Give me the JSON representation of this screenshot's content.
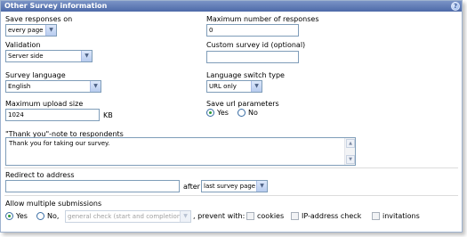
{
  "panel": {
    "title": "Other Survey information",
    "help_icon": "help-icon"
  },
  "left": {
    "save_responses_label": "Save responses on",
    "save_responses_value": "every page",
    "validation_label": "Validation",
    "validation_value": "Server side",
    "survey_language_label": "Survey language",
    "survey_language_value": "English",
    "max_upload_label": "Maximum upload size",
    "max_upload_value": "1024",
    "max_upload_unit": "KB"
  },
  "right": {
    "max_responses_label": "Maximum number of responses",
    "max_responses_value": "0",
    "custom_id_label": "Custom survey id (optional)",
    "custom_id_value": "",
    "lang_switch_label": "Language switch type",
    "lang_switch_value": "URL only",
    "save_url_label": "Save url parameters",
    "save_url_yes": "Yes",
    "save_url_no": "No",
    "save_url_selected": "Yes"
  },
  "thanks": {
    "label": "\"Thank you\"-note to respondents",
    "value": "Thank you for taking our survey."
  },
  "redirect": {
    "label": "Redirect to address",
    "value": "",
    "after_label": "after",
    "after_value": "last survey page"
  },
  "multiple": {
    "label": "Allow multiple submissions",
    "yes": "Yes",
    "no": "No,",
    "selected": "Yes",
    "check_value": "general check (start and completion)",
    "prevent_label": ", prevent with:",
    "opt_cookies": "cookies",
    "opt_ip": "IP-address check",
    "opt_invitations": "invitations"
  },
  "colors": {
    "title_bar": "#4d6aa8",
    "field_border": "#7f9db9",
    "radio_dot": "#2d9a36"
  }
}
